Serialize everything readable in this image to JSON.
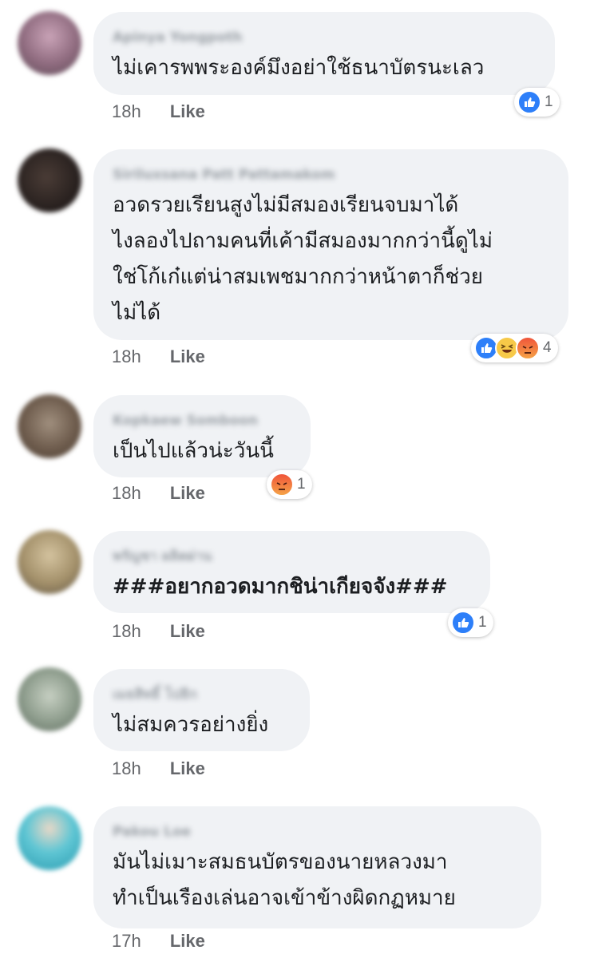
{
  "comments": [
    {
      "author": "Apinya Yongpoth",
      "text": "ไม่เคารพพระองค์มึงอย่าใช้ธนาบัตรนะเลว",
      "time": "18h",
      "like_label": "Like",
      "reactions": [
        "like-icon"
      ],
      "reaction_count": "1",
      "avatar_color": "#b493a6"
    },
    {
      "author": "Siriluxsana Patt Pattamakom",
      "text": "อวดรวยเรียนสูงไม่มีสมองเรียนจบมาได้\nไงลองไปถามคนที่เค้ามีสมองมากกว่านี้ดูไม่\nใช่โก้เก๋แต่น่าสมเพชมากกว่าหน้าตาก็ช่วย\nไม่ได้",
      "time": "18h",
      "like_label": "Like",
      "reactions": [
        "like-icon",
        "haha-icon",
        "angry-icon"
      ],
      "reaction_count": "4",
      "avatar_color": "#3a2f2c"
    },
    {
      "author": "Kopkaew Somboon",
      "text": "เป็นไปแล้วน่ะวันนี้",
      "time": "18h",
      "like_label": "Like",
      "reactions": [
        "angry-icon"
      ],
      "reaction_count": "1",
      "avatar_color": "#8a7868"
    },
    {
      "author": "พรัญชา ผลิตผ่าน",
      "text": "###อยากอวดมากชิน่าเกียจจัง###",
      "time": "18h",
      "like_label": "Like",
      "reactions": [
        "like-icon"
      ],
      "reaction_count": "1",
      "avatar_color": "#b9a47f",
      "bold": true
    },
    {
      "author": "เมธสิทธิ์ โปธิก",
      "text": "ไม่สมควรอย่างยิ่ง",
      "time": "18h",
      "like_label": "Like",
      "reactions": [],
      "reaction_count": "",
      "avatar_color": "#9aa79a"
    },
    {
      "author": "Pakou Loe",
      "text": "มันไม่เมาะสมธนบัตรของนายหลวงมา\nทำเป็นเรืองเล่นอาจเข้าข้างผิดกฏหมาย",
      "time": "17h",
      "like_label": "Like",
      "reactions": [],
      "reaction_count": "",
      "avatar_color": "#3fb7c8"
    }
  ]
}
